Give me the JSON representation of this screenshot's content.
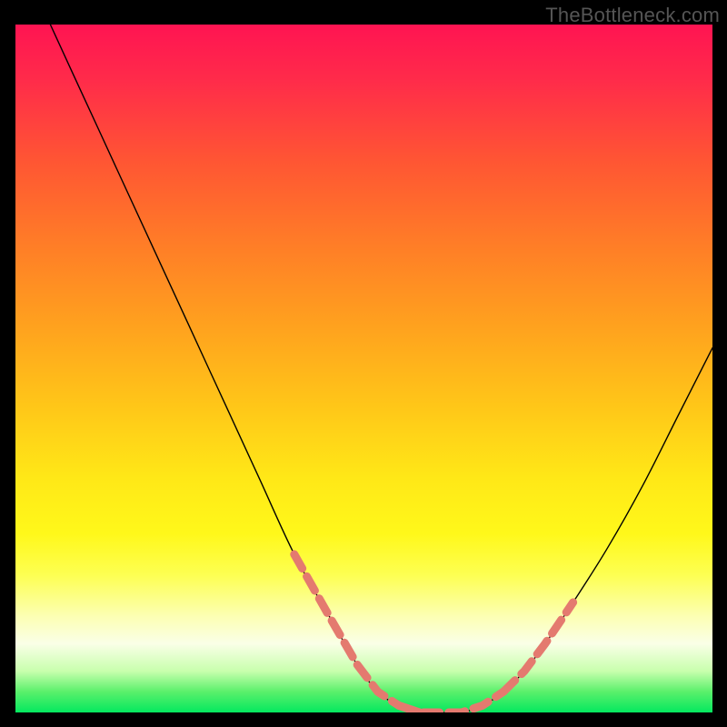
{
  "watermark": "TheBottleneck.com",
  "colors": {
    "frame_background": "#000000",
    "curve_stroke": "#000000",
    "dash_stroke": "#e47a6f",
    "gradient_stops": [
      "#ff1452",
      "#ff2b4a",
      "#ff5633",
      "#ff7d27",
      "#ffa21e",
      "#ffc818",
      "#ffe817",
      "#fff81a",
      "#fdff52",
      "#fcffb3",
      "#faffe7",
      "#c8ffad",
      "#5af06b",
      "#04e85f"
    ]
  },
  "chart_data": {
    "type": "line",
    "title": "",
    "xlabel": "",
    "ylabel": "",
    "xlim": [
      0,
      100
    ],
    "ylim": [
      0,
      100
    ],
    "series": [
      {
        "name": "bottleneck-curve",
        "x": [
          5,
          10,
          15,
          20,
          25,
          30,
          35,
          40,
          45,
          49,
          52,
          55,
          58,
          61,
          64,
          67,
          70,
          73,
          76,
          80,
          85,
          90,
          95,
          100
        ],
        "y": [
          100,
          89,
          78,
          67,
          56,
          45,
          34,
          23,
          14,
          7,
          3,
          1,
          0,
          0,
          0,
          1,
          3,
          6,
          10,
          16,
          24,
          33,
          43,
          53
        ]
      }
    ],
    "highlighted_segments": [
      {
        "name": "left-dashes",
        "x": [
          40,
          45,
          49,
          52,
          55,
          58
        ],
        "y": [
          23,
          14,
          7,
          3,
          1,
          0
        ]
      },
      {
        "name": "bottom-dashes",
        "x": [
          55,
          58,
          61,
          64,
          67,
          70
        ],
        "y": [
          1,
          0,
          0,
          0,
          1,
          3
        ]
      },
      {
        "name": "right-dashes",
        "x": [
          70,
          73,
          76,
          80
        ],
        "y": [
          3,
          6,
          10,
          16
        ]
      }
    ]
  }
}
